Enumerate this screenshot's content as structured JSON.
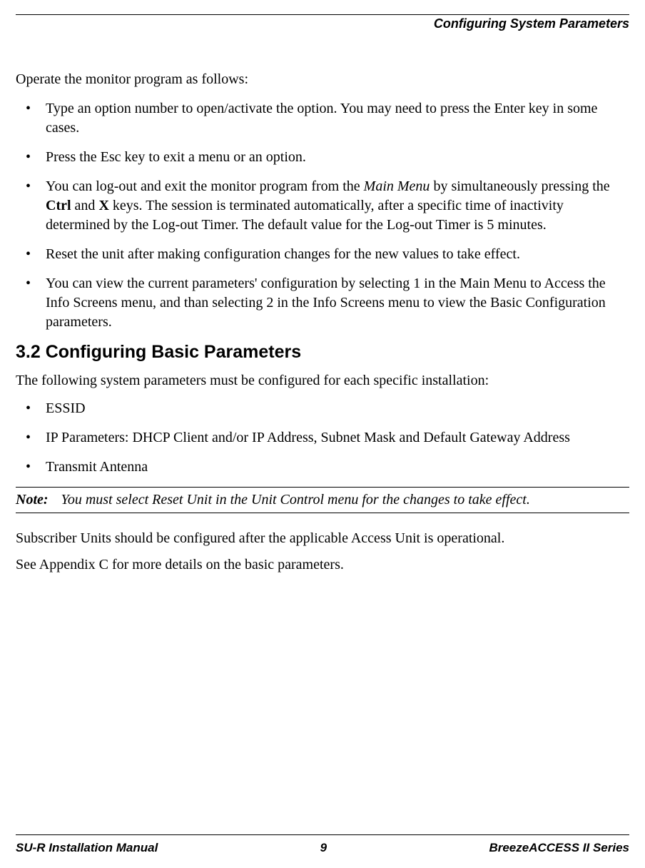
{
  "header": {
    "title": "Configuring System Parameters"
  },
  "intro": "Operate the monitor program as follows:",
  "operate_bullets": [
    {
      "segments": [
        {
          "text": "Type an option number to open/activate the option. You may need to press the Enter key in some cases."
        }
      ]
    },
    {
      "segments": [
        {
          "text": "Press the Esc key to exit a menu or an option."
        }
      ]
    },
    {
      "segments": [
        {
          "text": "You can log-out and exit the monitor program from the "
        },
        {
          "text": "Main Menu",
          "style": "italic"
        },
        {
          "text": " by simultaneously pressing the "
        },
        {
          "text": "Ctrl",
          "style": "bold"
        },
        {
          "text": " and "
        },
        {
          "text": "X",
          "style": "bold"
        },
        {
          "text": " keys. The session is terminated automatically, after a specific time of inactivity determined by the Log-out Timer. The default value for the Log-out Timer is 5 minutes."
        }
      ]
    },
    {
      "segments": [
        {
          "text": "Reset the unit after making configuration changes for the new values to take effect."
        }
      ]
    },
    {
      "segments": [
        {
          "text": "You can view the current parameters' configuration by selecting 1 in the Main Menu to Access the Info Screens menu, and than selecting 2 in the Info Screens menu to view the Basic Configuration parameters."
        }
      ]
    }
  ],
  "section": {
    "heading": "3.2  Configuring Basic Parameters",
    "lead": "The following system parameters must be configured for each specific installation:",
    "items": [
      "ESSID",
      "IP Parameters: DHCP Client and/or IP Address, Subnet Mask and Default Gateway Address",
      "Transmit Antenna"
    ]
  },
  "note": {
    "label": "Note:",
    "text": "You must select Reset Unit in the Unit Control menu for the changes to take effect."
  },
  "closing": [
    "Subscriber Units should be configured after the applicable Access Unit is operational.",
    "See Appendix C for more details on the basic parameters."
  ],
  "footer": {
    "left": "SU-R Installation Manual",
    "center": "9",
    "right": "BreezeACCESS II Series"
  }
}
